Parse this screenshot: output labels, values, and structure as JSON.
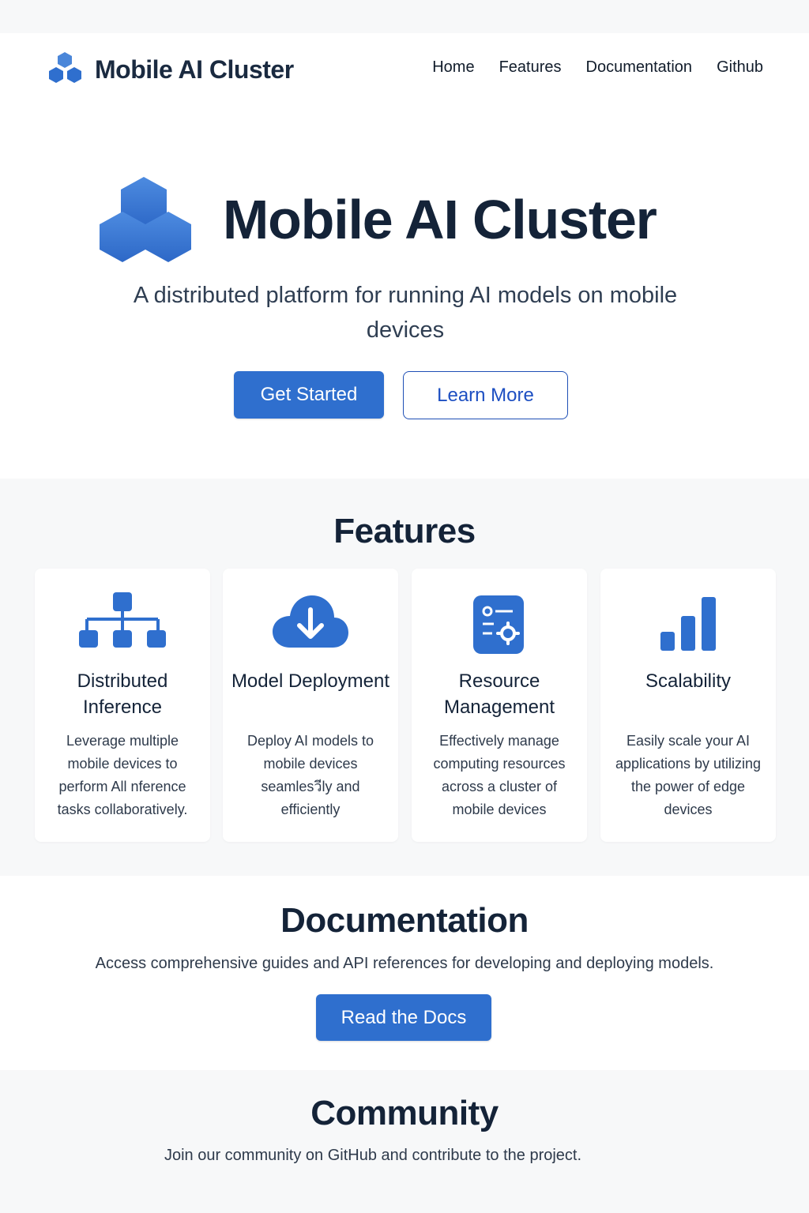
{
  "colors": {
    "accent": "#2f6fce",
    "accent_dark": "#1e4fb5",
    "heading": "#142338",
    "section_bg": "#f7f8f9"
  },
  "header": {
    "brand": "Mobile AI Cluster",
    "logo_icon": "hexagon-cluster-icon",
    "nav": [
      "Home",
      "Features",
      "Documentation",
      "Github"
    ]
  },
  "hero": {
    "title": "Mobile AI Cluster",
    "subtitle": "A distributed platform for running AI models on mobile devices",
    "primary_button": "Get Started",
    "secondary_button": "Learn More"
  },
  "features": {
    "title": "Features",
    "cards": [
      {
        "icon": "network-tree-icon",
        "title": "Distributed Inference",
        "description": "Leverage  multiple mobile devices to perform All nference tasks collaboratively."
      },
      {
        "icon": "cloud-download-icon",
        "title": "Model Deployment",
        "description": "Deploy AI models to mobile devices seamlesวีly and efficiently"
      },
      {
        "icon": "resource-settings-icon",
        "title": "Resource Management",
        "description": "Effectively manage computing resources across a cluster of mobile devices"
      },
      {
        "icon": "bar-chart-icon",
        "title": "Scalability",
        "description": "Easily scale your AI applications by utilizing the power of edge devices"
      }
    ]
  },
  "documentation": {
    "title": "Documentation",
    "text": "Access comprehensive guides and API references for developing and deploying models.",
    "button": "Read the Docs"
  },
  "community": {
    "title": "Community",
    "text": "Join our community on GitHub and contribute to the project."
  }
}
